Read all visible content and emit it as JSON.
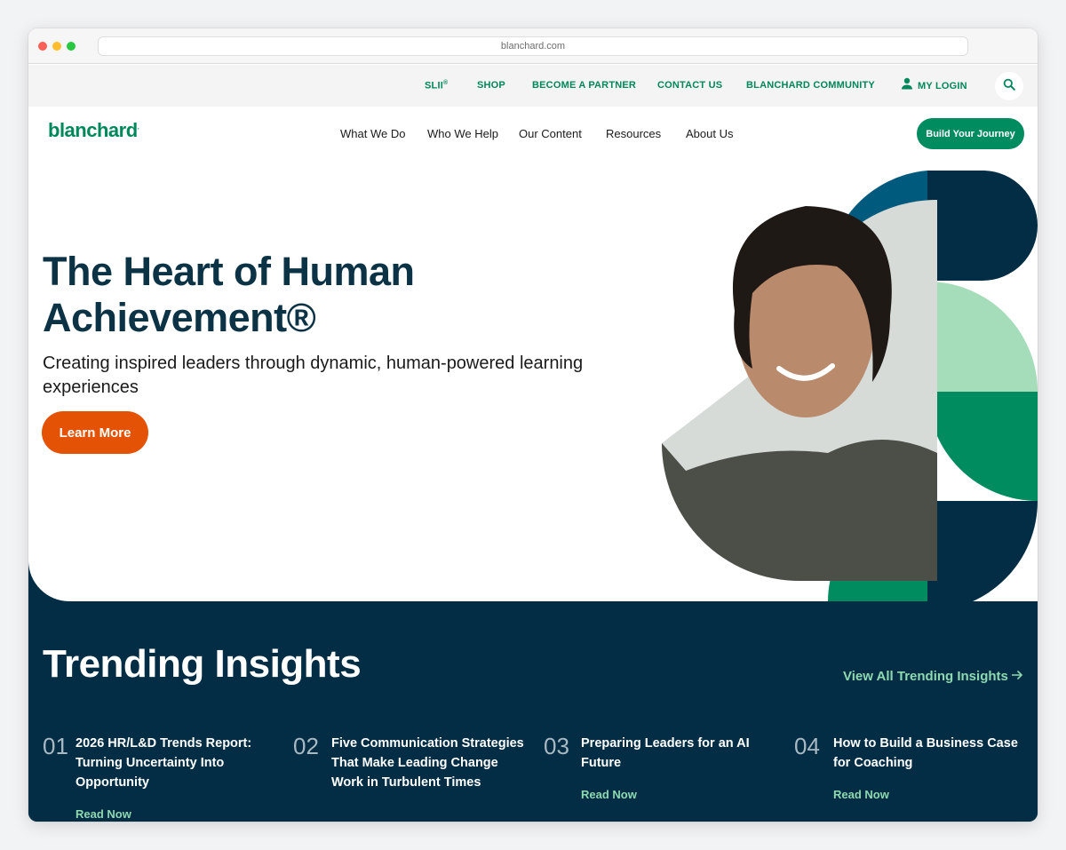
{
  "browser": {
    "url": "blanchard.com"
  },
  "utility_nav": {
    "items": [
      "SLII",
      "SHOP",
      "BECOME A PARTNER",
      "CONTACT US",
      "BLANCHARD COMMUNITY"
    ],
    "sl_superscript": "®",
    "login_label": "MY LOGIN"
  },
  "main_nav": {
    "logo_text": "blanchard",
    "logo_reg": ".",
    "items": [
      "What We Do",
      "Who We Help",
      "Our Content",
      "Resources",
      "About Us"
    ],
    "cta_label": "Build Your Journey"
  },
  "hero": {
    "title_line1": "The Heart of Human",
    "title_line2": "Achievement®",
    "subtitle": "Creating inspired leaders through dynamic, human-powered learning experiences",
    "button_label": "Learn More"
  },
  "trending": {
    "title": "Trending Insights",
    "view_all_label": "View All Trending Insights",
    "items": [
      {
        "num": "01",
        "title": "2026 HR/L&D Trends Report: Turning Uncertainty Into Opportunity",
        "cta": "Read Now"
      },
      {
        "num": "02",
        "title": "Five Communication Strategies That Make Leading Change Work in Turbulent Times",
        "cta": "Read Now"
      },
      {
        "num": "03",
        "title": "Preparing Leaders for an AI Future",
        "cta": "Read Now"
      },
      {
        "num": "04",
        "title": "How to Build a Business Case for Coaching",
        "cta": "Read Now"
      }
    ]
  },
  "colors": {
    "brand_green": "#00875a",
    "navy": "#022d44",
    "orange": "#e35205",
    "light_green": "#a5dcb9",
    "blue": "#005a7e"
  }
}
